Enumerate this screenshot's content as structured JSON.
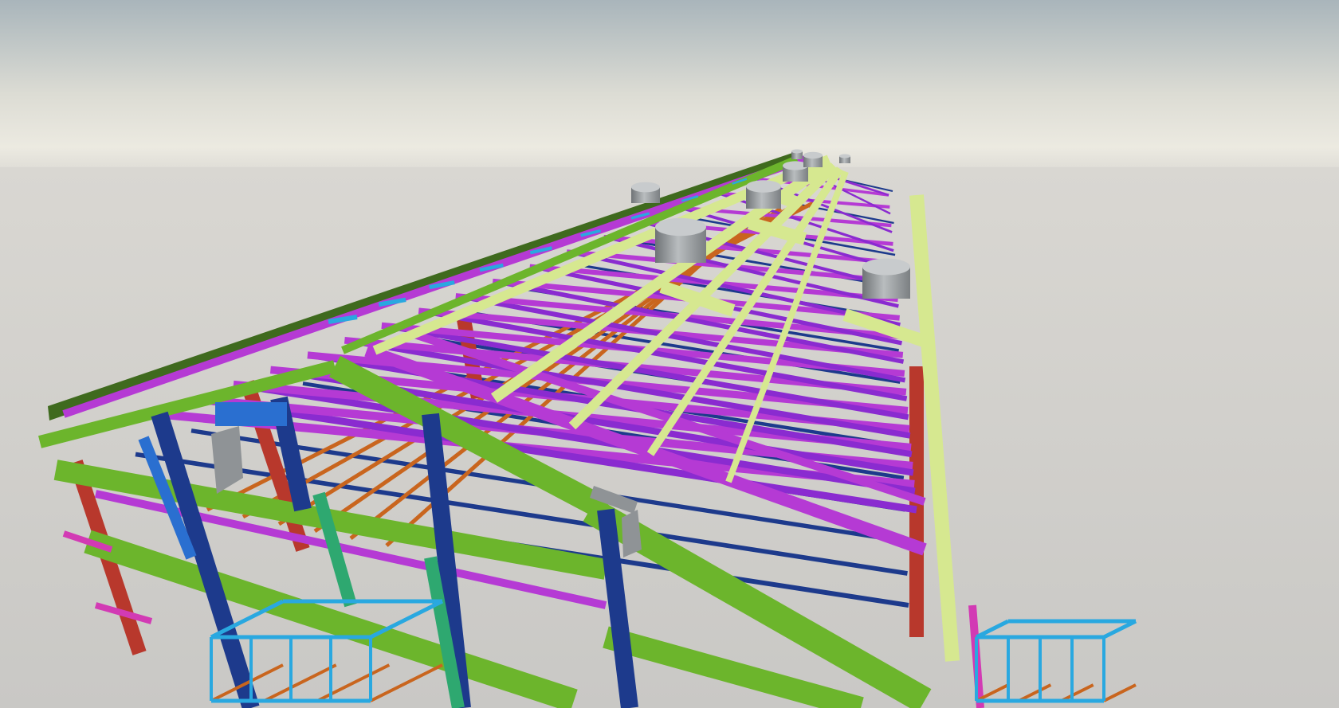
{
  "viewport": {
    "kind": "3d-steel-structure-render",
    "background": {
      "sky_top": "#a9b5bb",
      "horizon_glow": "#e8e6de",
      "ground": "#cfcecb"
    }
  },
  "members": {
    "colors": {
      "primary_rafter_green": "#6cb52c",
      "secondary_purlin_yellow": "#d6e890",
      "bracing_purple": "#b53ad4",
      "bracing_violet": "#8a2bd0",
      "tie_navy": "#1d3a8c",
      "column_blue": "#2a6fd0",
      "girt_orange": "#c9651e",
      "column_red": "#b8382c",
      "edge_dark_green": "#3f6a1e",
      "walkway_cyan": "#29a8e0",
      "column_teal": "#2ea870",
      "plate_grey": "#8f9396",
      "magenta_trim": "#d23ab4"
    },
    "counts": {
      "roof_vents": 8,
      "walkways": 2
    }
  }
}
